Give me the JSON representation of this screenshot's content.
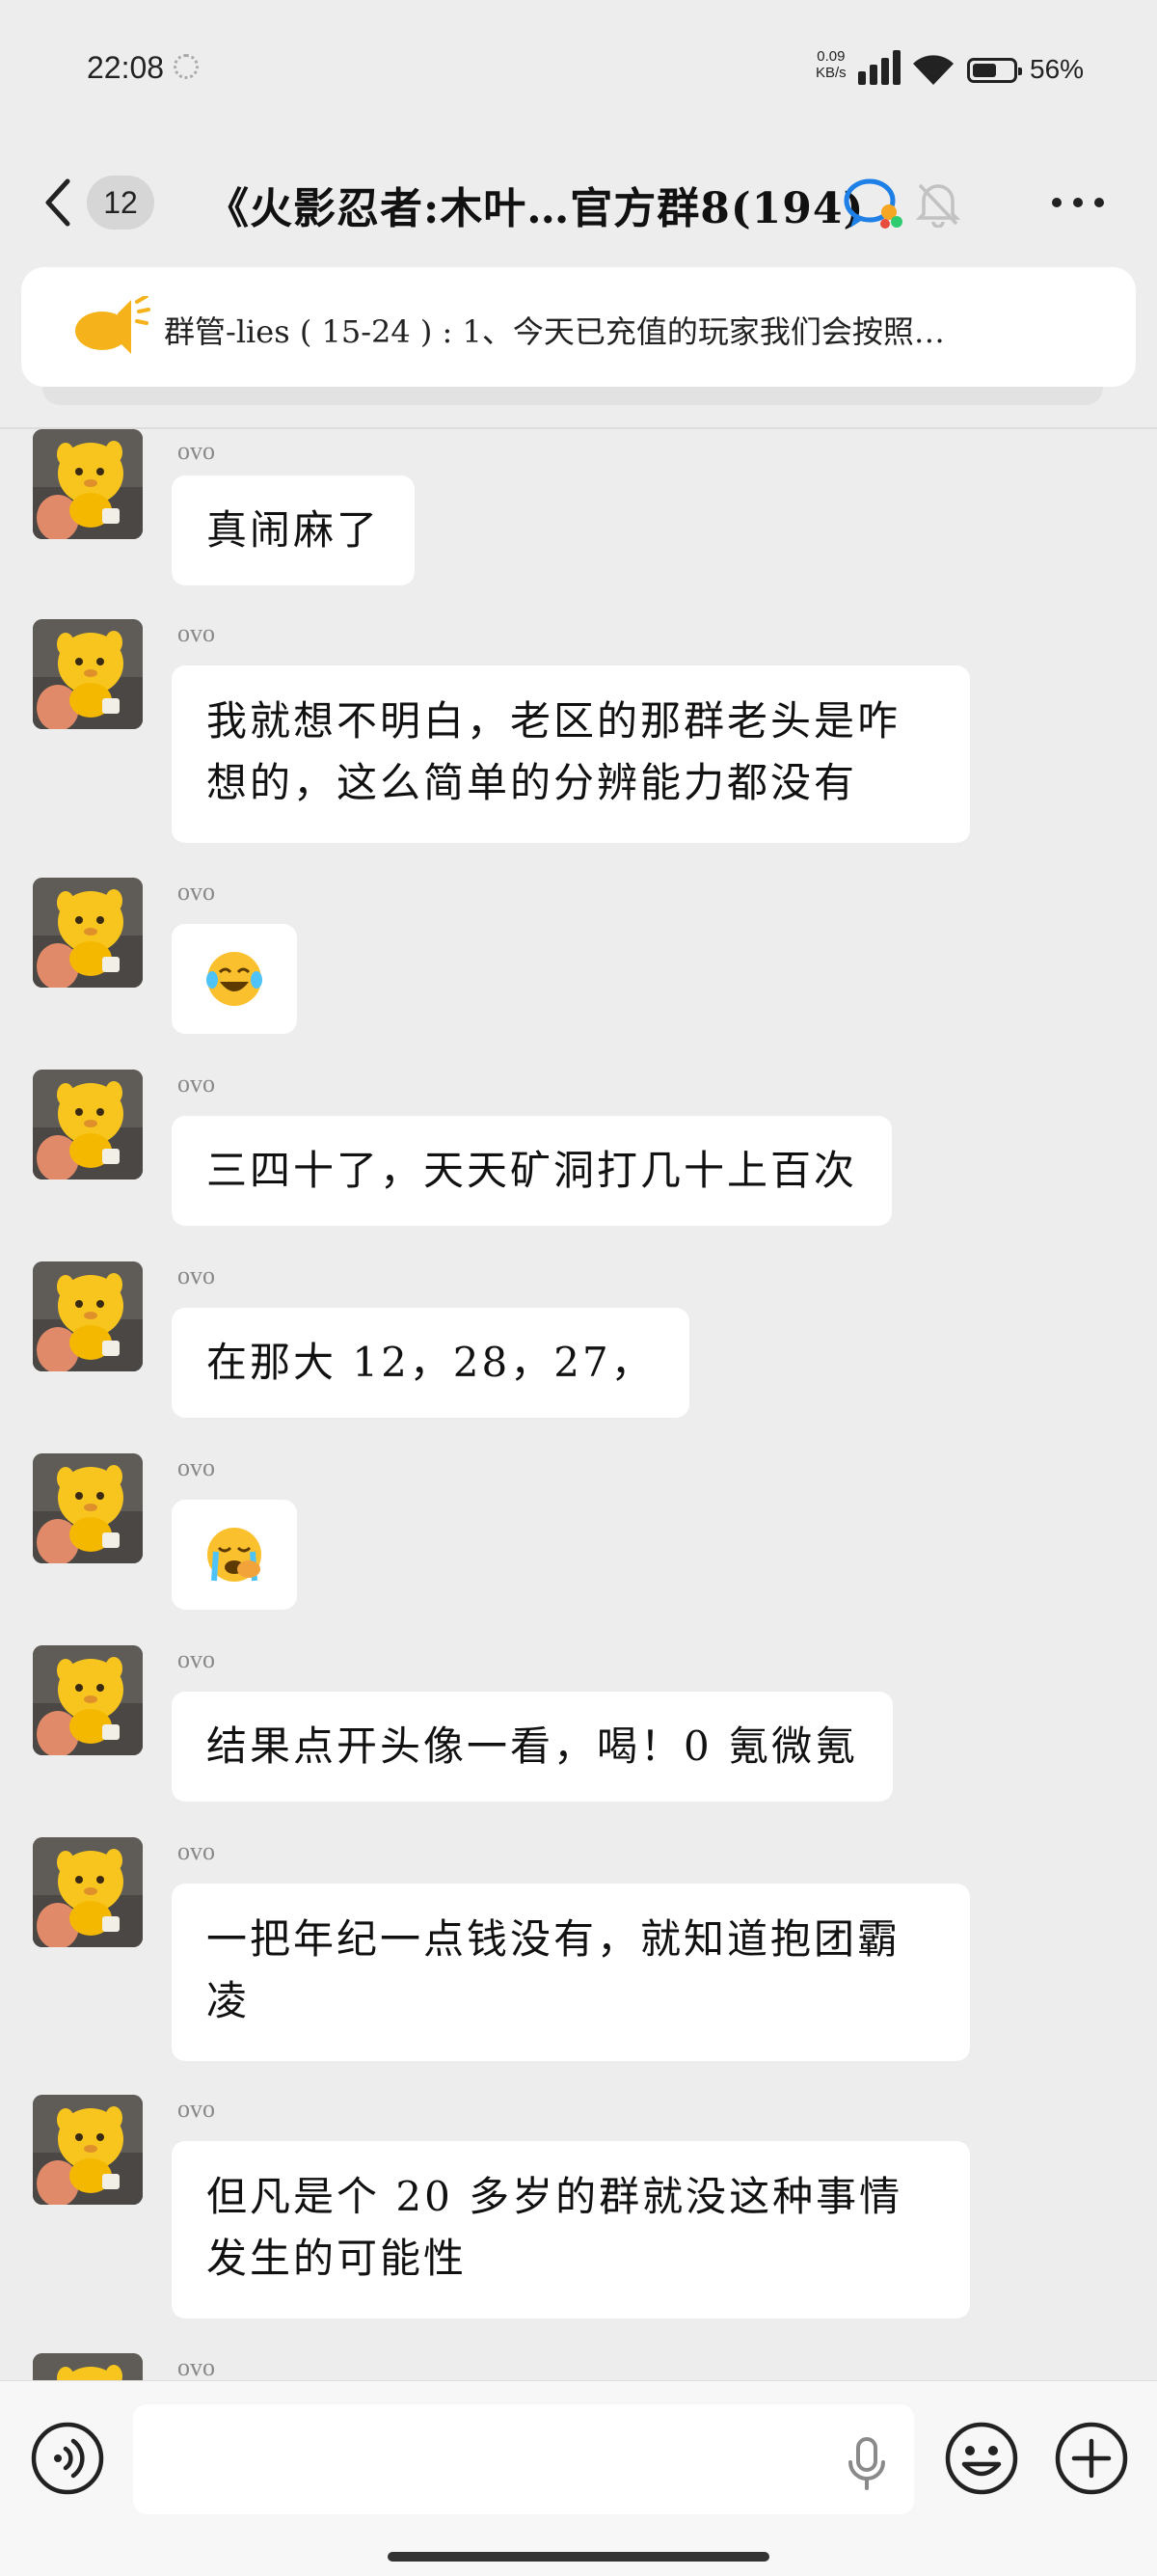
{
  "status_bar": {
    "time": "22:08",
    "net_speed_value": "0.09",
    "net_speed_unit": "KB/s",
    "battery_percent": "56%",
    "battery_level": 0.56
  },
  "header": {
    "unread_count": "12",
    "title": "《火影忍者:木叶…官方群8(194)"
  },
  "notice": {
    "text": "群管-lies ( 15-24 ) : 1、今天已充值的玩家我们会按照…"
  },
  "messages": [
    {
      "sender": "ovo",
      "text": "真闹麻了"
    },
    {
      "sender": "ovo",
      "text": "我就想不明白，老区的那群老头是咋想的，这么简单的分辨能力都没有"
    },
    {
      "sender": "ovo",
      "emoji": "face-with-tears-of-joy"
    },
    {
      "sender": "ovo",
      "text": "三四十了，天天矿洞打几十上百次"
    },
    {
      "sender": "ovo",
      "text": "在那大 12，28，27，"
    },
    {
      "sender": "ovo",
      "emoji": "loudly-crying-face"
    },
    {
      "sender": "ovo",
      "text": "结果点开头像一看，喝！0 氪微氪"
    },
    {
      "sender": "ovo",
      "text": "一把年纪一点钱没有，就知道抱团霸凌"
    },
    {
      "sender": "ovo",
      "text": "但凡是个 20 多岁的群就没这种事情发生的可能性"
    },
    {
      "sender": "ovo"
    }
  ],
  "input_bar": {
    "placeholder": ""
  },
  "colors": {
    "background": "#ededed",
    "bubble": "#ffffff",
    "notice_icon": "#f5b21b",
    "avatar_character": "#f7c51e"
  }
}
